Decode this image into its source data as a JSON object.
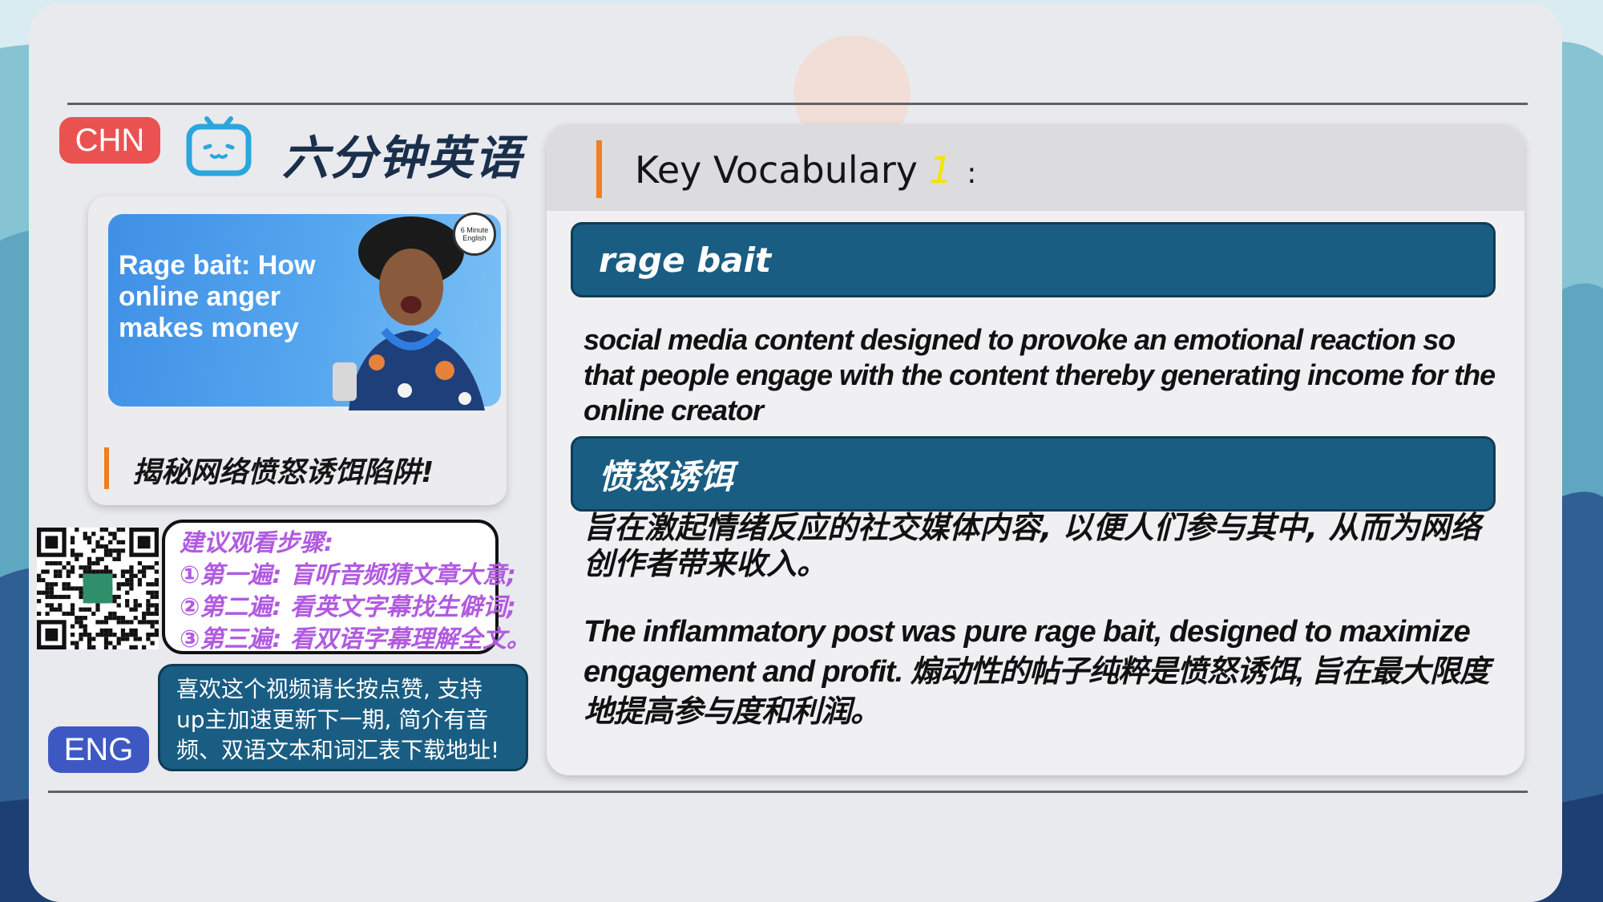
{
  "colors": {
    "accent_orange": "#f07f1e",
    "term_bar_blue": "#1a5d83",
    "chn_badge_red": "#ea5252",
    "eng_badge_blue": "#3e58c3",
    "steps_purple": "#b15ae0"
  },
  "header": {
    "chn_label": "CHN",
    "eng_label": "ENG",
    "show_title": "六分钟英语",
    "icon": "tv-icon"
  },
  "thumbnail": {
    "title_lines": [
      "Rage bait: How",
      "online anger",
      "makes money"
    ],
    "logo_text": "6 Minute English",
    "caption": "揭秘网络愤怒诱饵陷阱!"
  },
  "steps": {
    "heading": "建议观看步骤:",
    "items": [
      "①第一遍: 盲听音频猜文章大意;",
      "②第二遍: 看英文字幕找生僻词;",
      "③第三遍: 看双语字幕理解全文。"
    ]
  },
  "like_note": {
    "lines": [
      "喜欢这个视频请长按点赞, 支持",
      "up主加速更新下一期, 简介有音",
      "频、双语文本和词汇表下载地址!"
    ]
  },
  "vocab": {
    "title": "Key Vocabulary",
    "number": "1",
    "colon": ":",
    "term_en": "rage bait",
    "definition_en": "social media content designed to provoke an emotional reaction so that people engage with the content thereby generating income for the online creator",
    "term_zh": "愤怒诱饵",
    "definition_zh": "旨在激起情绪反应的社交媒体内容, 以便人们参与其中, 从而为网络创作者带来收入。",
    "example": "The inflammatory post was pure rage bait, designed to maximize engagement and profit. 煽动性的帖子纯粹是愤怒诱饵, 旨在最大限度地提高参与度和利润。"
  }
}
